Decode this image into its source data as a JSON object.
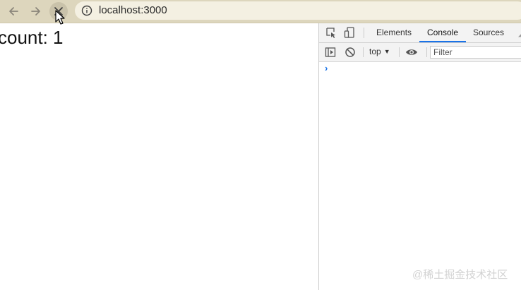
{
  "browser": {
    "url": "localhost:3000",
    "icons": {
      "back": "arrow-left-icon",
      "forward": "arrow-right-icon",
      "stop": "close-icon",
      "info": "info-icon",
      "cursor": "mouse-cursor-icon"
    }
  },
  "page": {
    "count_text": "count: 1"
  },
  "devtools": {
    "tabs": [
      {
        "label": "Elements",
        "active": false
      },
      {
        "label": "Console",
        "active": true
      },
      {
        "label": "Sources",
        "active": false
      }
    ],
    "more_tabs_glyph": "◢",
    "console_toolbar": {
      "context": "top",
      "context_arrow": "▼",
      "filter_placeholder": "Filter"
    },
    "prompt": "›"
  },
  "watermark": "@稀土掘金技术社区",
  "colors": {
    "toolbar_bg": "#ddd6bd",
    "address_bg": "#f4f0e2",
    "active_tab_underline": "#1a73e8",
    "devtools_bg": "#f3f3f3"
  }
}
